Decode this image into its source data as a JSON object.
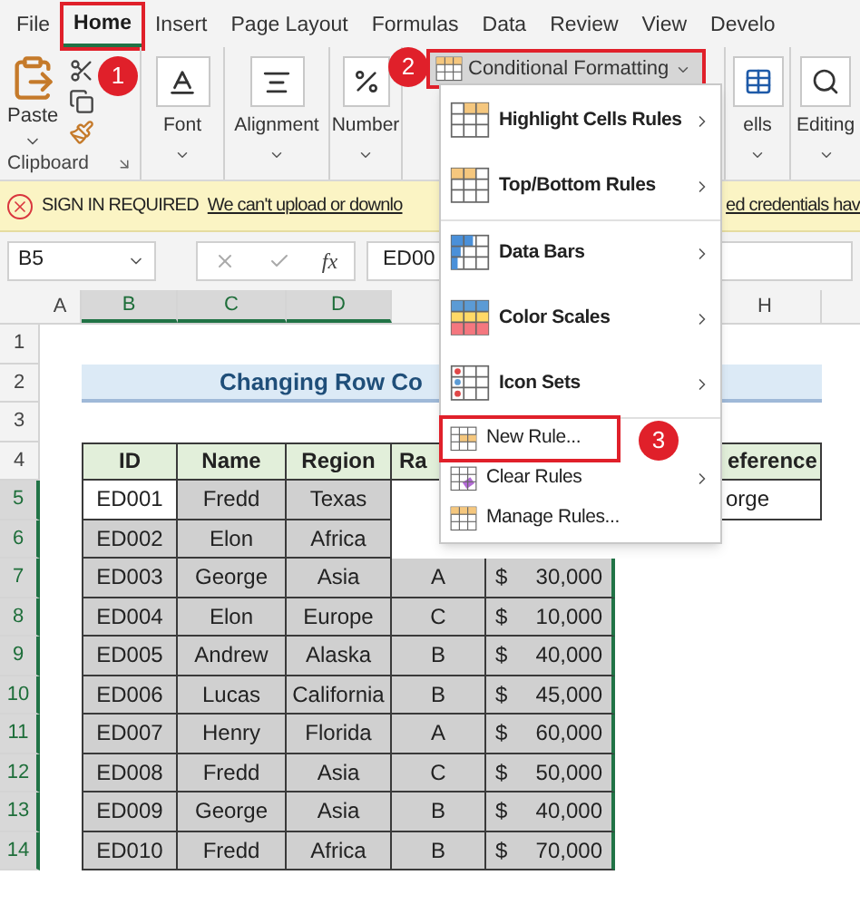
{
  "tabs": [
    {
      "label": "File",
      "selected": false,
      "highlighted": false
    },
    {
      "label": "Home",
      "selected": true,
      "highlighted": true
    },
    {
      "label": "Insert",
      "selected": false,
      "highlighted": false
    },
    {
      "label": "Page Layout",
      "selected": false,
      "highlighted": false
    },
    {
      "label": "Formulas",
      "selected": false,
      "highlighted": false
    },
    {
      "label": "Data",
      "selected": false,
      "highlighted": false
    },
    {
      "label": "Review",
      "selected": false,
      "highlighted": false
    },
    {
      "label": "View",
      "selected": false,
      "highlighted": false
    },
    {
      "label": "Develo",
      "selected": false,
      "highlighted": false
    }
  ],
  "ribbon": {
    "clipboard": {
      "paste_label": "Paste",
      "group_label": "Clipboard"
    },
    "groups": [
      {
        "kind": "font",
        "label": "Font"
      },
      {
        "kind": "alignment",
        "label": "Alignment"
      },
      {
        "kind": "number",
        "label": "Number"
      },
      {
        "kind": "conditional",
        "label": "Conditional Formatting",
        "highlighted": true
      },
      {
        "kind": "cells",
        "label": "ells"
      },
      {
        "kind": "editing",
        "label": "Editing"
      }
    ]
  },
  "notification": {
    "title": "SIGN IN REQUIRED",
    "message_start": "We can't upload or downlo",
    "message_end": "ed credentials hav"
  },
  "formula_bar": {
    "name_box": "B5",
    "fx_label": "fx",
    "value": "ED00"
  },
  "column_headers": [
    "A",
    "B",
    "C",
    "D",
    "H"
  ],
  "row_numbers": [
    "1",
    "2",
    "3",
    "4",
    "5",
    "6",
    "7",
    "8",
    "9",
    "10",
    "11",
    "12",
    "13",
    "14"
  ],
  "sheet": {
    "title": "Changing Row Co",
    "table_headers": [
      "ID",
      "Name",
      "Region",
      "Ra"
    ],
    "reference_header": "eference",
    "reference_value": "orge",
    "rows": [
      {
        "id": "ED001",
        "name": "Fredd",
        "region": "Texas",
        "active": true
      },
      {
        "id": "ED002",
        "name": "Elon",
        "region": "Africa",
        "active": false
      },
      {
        "id": "ED003",
        "name": "George",
        "region": "Asia",
        "rank": "A",
        "currency": "$",
        "salary": "30,000",
        "active": false
      },
      {
        "id": "ED004",
        "name": "Elon",
        "region": "Europe",
        "rank": "C",
        "currency": "$",
        "salary": "10,000",
        "active": false
      },
      {
        "id": "ED005",
        "name": "Andrew",
        "region": "Alaska",
        "rank": "B",
        "currency": "$",
        "salary": "40,000",
        "active": false
      },
      {
        "id": "ED006",
        "name": "Lucas",
        "region": "California",
        "rank": "B",
        "currency": "$",
        "salary": "45,000",
        "active": false
      },
      {
        "id": "ED007",
        "name": "Henry",
        "region": "Florida",
        "rank": "A",
        "currency": "$",
        "salary": "60,000",
        "active": false
      },
      {
        "id": "ED008",
        "name": "Fredd",
        "region": "Asia",
        "rank": "C",
        "currency": "$",
        "salary": "50,000",
        "active": false
      },
      {
        "id": "ED009",
        "name": "George",
        "region": "Asia",
        "rank": "B",
        "currency": "$",
        "salary": "40,000",
        "active": false
      },
      {
        "id": "ED010",
        "name": "Fredd",
        "region": "Africa",
        "rank": "B",
        "currency": "$",
        "salary": "70,000",
        "active": false
      }
    ]
  },
  "menu": {
    "sections": [
      [
        {
          "kind": "highlight",
          "label": "Highlight Cells Rules",
          "submenu": true,
          "highlighted": false
        },
        {
          "kind": "topbottom",
          "label": "Top/Bottom Rules",
          "submenu": true,
          "highlighted": false
        }
      ],
      [
        {
          "kind": "databars",
          "label": "Data Bars",
          "submenu": true,
          "highlighted": false
        },
        {
          "kind": "colorscales",
          "label": "Color Scales",
          "submenu": true,
          "highlighted": false
        },
        {
          "kind": "iconsets",
          "label": "Icon Sets",
          "submenu": true,
          "highlighted": false
        }
      ],
      [
        {
          "kind": "newrule",
          "label": "New Rule...",
          "submenu": false,
          "highlighted": true
        },
        {
          "kind": "clearrules",
          "label": "Clear Rules",
          "submenu": true,
          "highlighted": false
        },
        {
          "kind": "managerules",
          "label": "Manage Rules...",
          "submenu": false,
          "highlighted": false
        }
      ]
    ]
  },
  "annotations": [
    "1",
    "2",
    "3"
  ]
}
